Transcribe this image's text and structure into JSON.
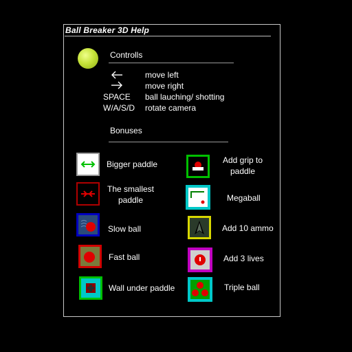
{
  "window": {
    "title": "Ball Breaker 3D Help"
  },
  "controls": {
    "heading": "Controlls",
    "rows": [
      {
        "key": "←",
        "key_icon": "arrow-left-icon",
        "desc": "move left"
      },
      {
        "key": "→",
        "key_icon": "arrow-right-icon",
        "desc": "move right"
      },
      {
        "key": "SPACE",
        "desc": "ball lauching/ shotting"
      },
      {
        "key": "W/A/S/D",
        "desc": "rotate camera"
      }
    ]
  },
  "bonuses": {
    "heading": "Bonuses",
    "left": [
      {
        "label": "Bigger paddle",
        "icon": "bigger-paddle-icon"
      },
      {
        "label_lines": [
          "The smallest",
          "paddle"
        ],
        "icon": "smallest-paddle-icon"
      },
      {
        "label": "Slow ball",
        "icon": "slow-ball-icon"
      },
      {
        "label": "Fast ball",
        "icon": "fast-ball-icon"
      },
      {
        "label": "Wall under paddle",
        "icon": "wall-under-paddle-icon"
      }
    ],
    "right": [
      {
        "label_lines": [
          "Add grip to",
          "paddle"
        ],
        "icon": "grip-paddle-icon"
      },
      {
        "label": "Megaball",
        "icon": "megaball-icon"
      },
      {
        "label": "Add 10 ammo",
        "icon": "ammo-icon"
      },
      {
        "label": "Add 3 lives",
        "icon": "lives-icon"
      },
      {
        "label": "Triple ball",
        "icon": "triple-ball-icon"
      }
    ]
  },
  "colors": {
    "background": "#000000",
    "panel_border": "#c8c8c8",
    "text": "#ffffff",
    "bonus_green": "#00c000",
    "bonus_red": "#e00000"
  }
}
